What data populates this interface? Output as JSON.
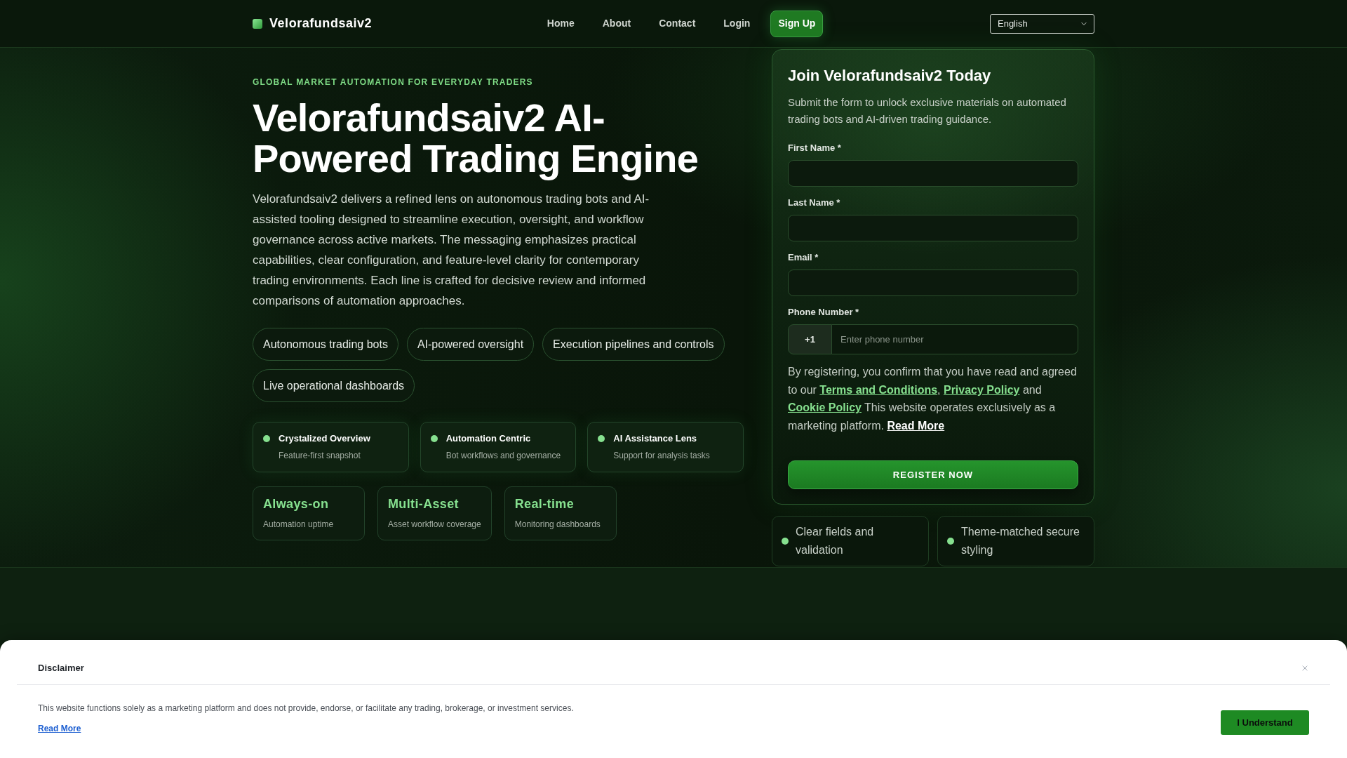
{
  "header": {
    "brand": "Velorafundsaiv2",
    "nav": [
      {
        "label": "Home",
        "kind": "link"
      },
      {
        "label": "About",
        "kind": "link"
      },
      {
        "label": "Contact",
        "kind": "link"
      },
      {
        "label": "Login",
        "kind": "link"
      },
      {
        "label": "Sign Up",
        "kind": "button"
      }
    ],
    "language": {
      "value": "English"
    }
  },
  "hero": {
    "eyebrow": "GLOBAL MARKET AUTOMATION FOR EVERYDAY TRADERS",
    "title": "Velorafundsaiv2 AI-Powered Trading Engine",
    "description": "Velorafundsaiv2 delivers a refined lens on autonomous trading bots and AI-assisted tooling designed to streamline execution, oversight, and workflow governance across active markets. The messaging emphasizes practical capabilities, clear configuration, and feature-level clarity for contemporary trading environments. Each line is crafted for decisive review and informed comparisons of automation approaches.",
    "chips": [
      "Autonomous trading bots",
      "AI-powered oversight",
      "Execution pipelines and controls",
      "Live operational dashboards"
    ],
    "highlights": [
      {
        "title": "Crystalized Overview",
        "subtitle": "Feature-first snapshot"
      },
      {
        "title": "Automation Centric",
        "subtitle": "Bot workflows and governance"
      },
      {
        "title": "AI Assistance Lens",
        "subtitle": "Support for analysis tasks"
      }
    ],
    "stats": [
      {
        "value": "Always-on",
        "label": "Automation uptime"
      },
      {
        "value": "Multi-Asset",
        "label": "Asset workflow coverage"
      },
      {
        "value": "Real-time",
        "label": "Monitoring dashboards"
      }
    ]
  },
  "signup_form": {
    "title": "Join Velorafundsaiv2 Today",
    "subtitle": "Submit the form to unlock exclusive materials on automated trading bots and AI-driven trading guidance.",
    "fields": [
      {
        "label": "First Name *",
        "kind": "input"
      },
      {
        "label": "Last Name *",
        "kind": "input"
      },
      {
        "label": "Email *",
        "kind": "input"
      },
      {
        "label": "Phone Number *",
        "kind": "phone",
        "prefix": "+1",
        "placeholder": "Enter phone number"
      }
    ],
    "consent": [
      {
        "kind": "text",
        "text": "By registering, you confirm that you have read and agreed to our "
      },
      {
        "kind": "link",
        "text": "Terms and Conditions"
      },
      {
        "kind": "text",
        "text": ", "
      },
      {
        "kind": "link",
        "text": "Privacy Policy"
      },
      {
        "kind": "text",
        "text": " and "
      },
      {
        "kind": "link",
        "text": "Cookie Policy"
      },
      {
        "kind": "text",
        "text": " This website operates exclusively as a marketing platform. "
      },
      {
        "kind": "read_more",
        "text": "Read More"
      }
    ],
    "submit": "REGISTER NOW"
  },
  "form_notes": [
    "Clear fields and validation",
    "Theme-matched secure styling"
  ],
  "disclaimer": {
    "title": "Disclaimer",
    "text": "This website functions solely as a marketing platform and does not provide, endorse, or facilitate any trading, brokerage, or investment services.",
    "link": "Read More",
    "button": "I Understand"
  }
}
